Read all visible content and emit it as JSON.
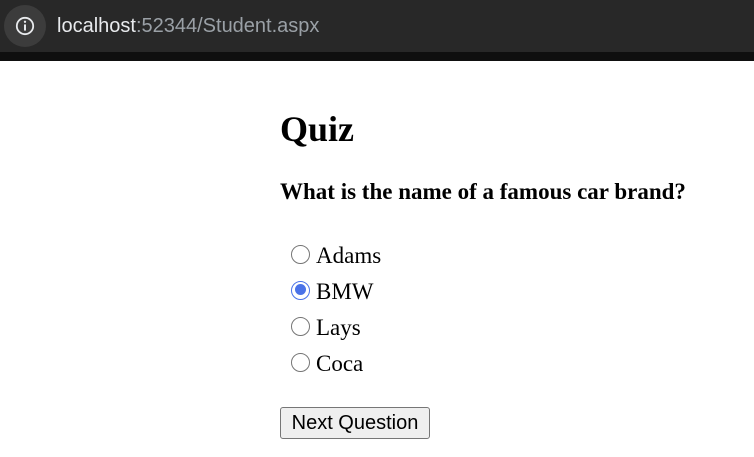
{
  "browser": {
    "url_host": "localhost",
    "url_rest": ":52344/Student.aspx",
    "info_icon": "info-icon"
  },
  "page": {
    "title": "Quiz",
    "question": "What is the name of a famous car brand?",
    "options": [
      {
        "label": "Adams",
        "checked": false
      },
      {
        "label": "BMW",
        "checked": true
      },
      {
        "label": "Lays",
        "checked": false
      },
      {
        "label": "Coca",
        "checked": false
      }
    ],
    "selected_option": "BMW",
    "next_button": "Next Question"
  },
  "colors": {
    "chrome_background": "#282828",
    "radio_accent": "#4a72e8",
    "button_background": "#efefef"
  }
}
